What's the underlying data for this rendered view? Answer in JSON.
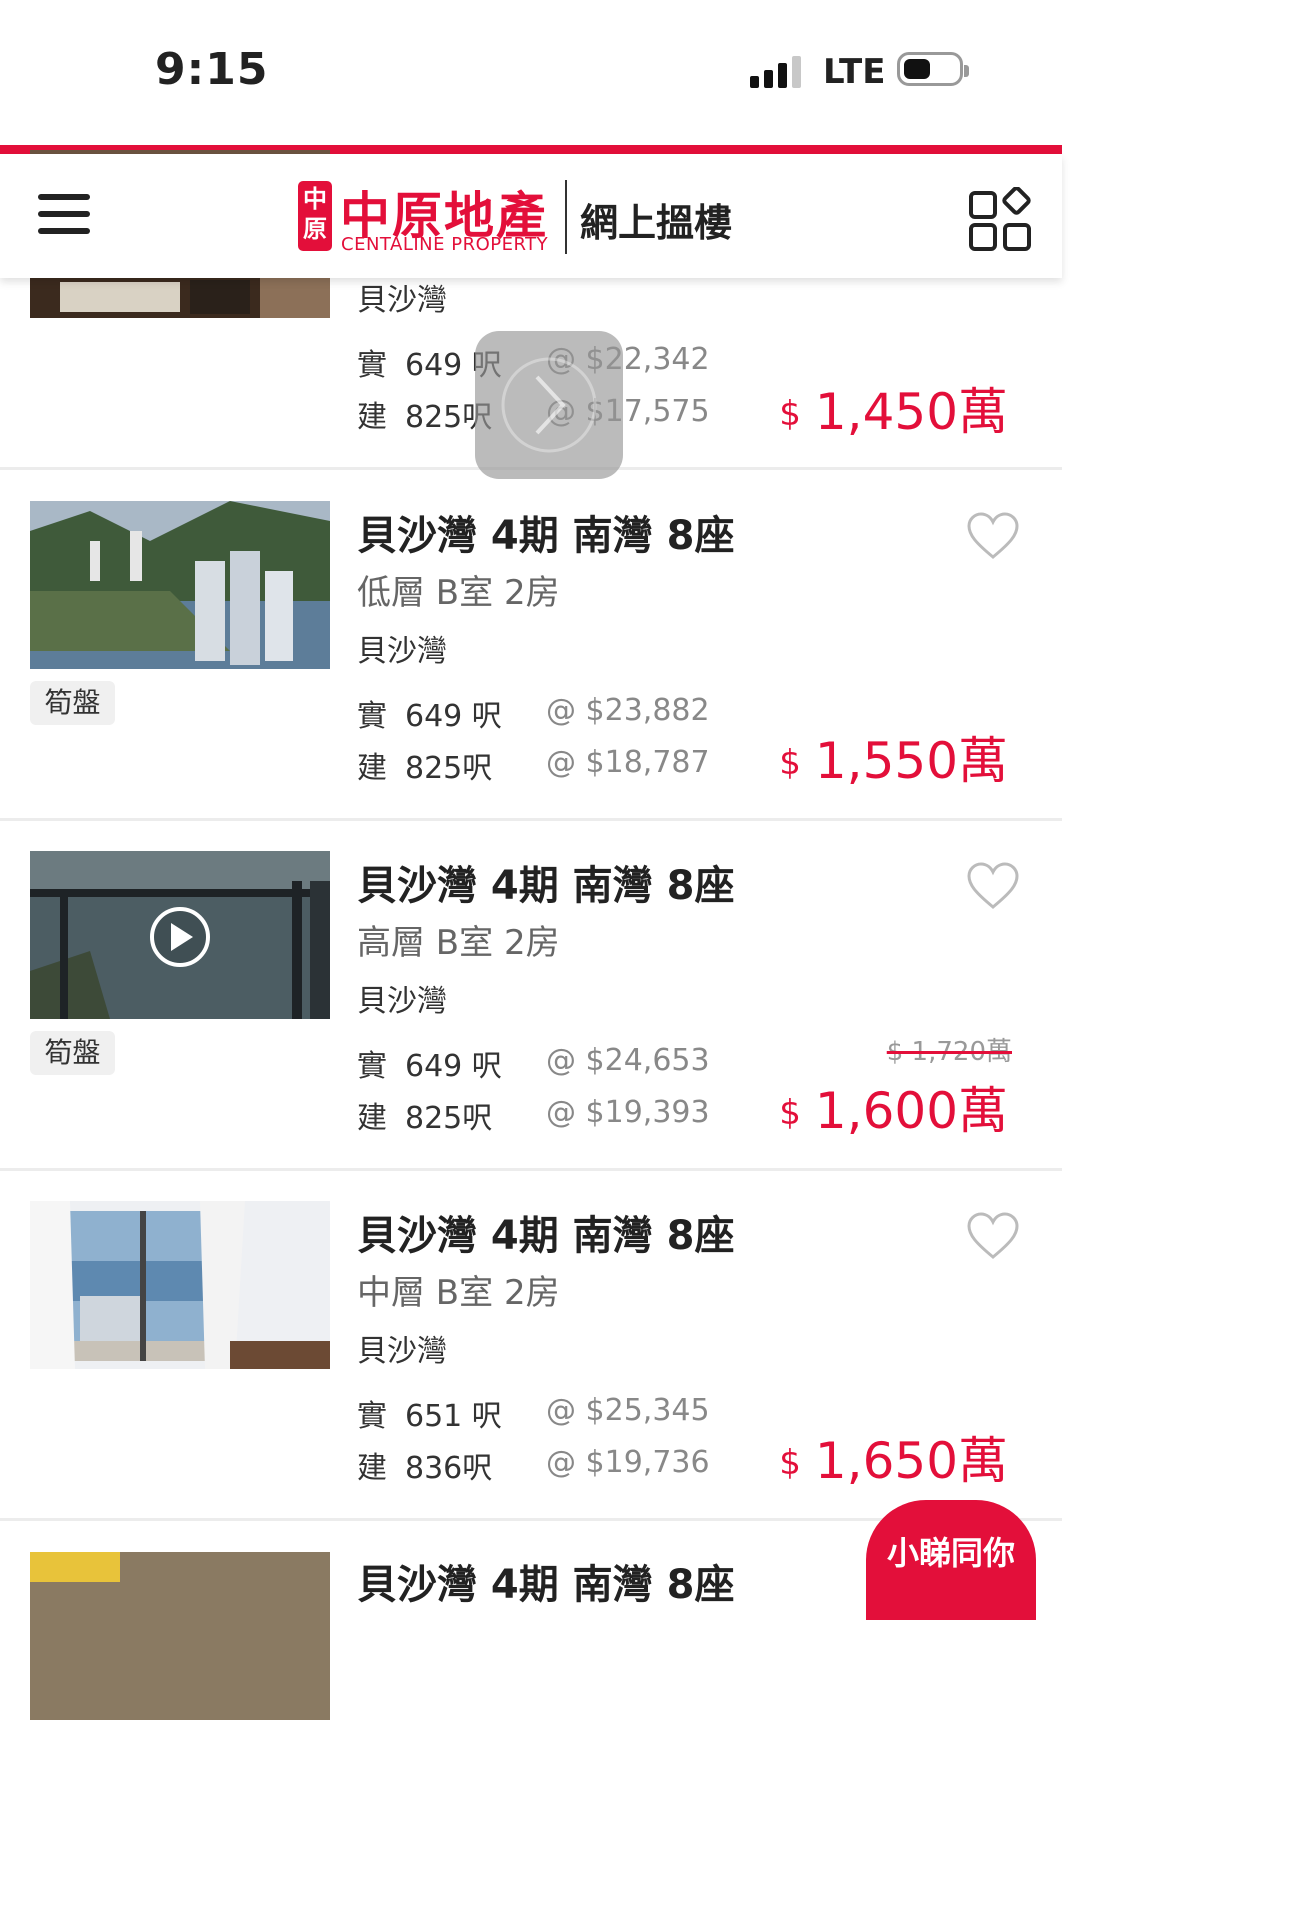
{
  "status_bar": {
    "time": "9:15",
    "network": "LTE"
  },
  "header": {
    "logo_seal": "中原",
    "logo_name": "中原地產",
    "logo_english": "CENTALINE PROPERTY",
    "tagline": "網上搵樓",
    "menu_icon": "hamburger-menu-icon",
    "apps_icon": "apps-grid-icon"
  },
  "colors": {
    "brand_red": "#e30f3a",
    "text": "#222222",
    "muted": "#888888"
  },
  "listings": [
    {
      "title": "",
      "subtitle": "",
      "district": "貝沙灣",
      "tag": "",
      "net_label": "實",
      "net_area": "649 呎",
      "net_unit_price": "@ $22,342",
      "gross_label": "建",
      "gross_area": "825呎",
      "gross_unit_price": "@ $17,575",
      "currency": "$",
      "price": "1,450萬",
      "old_price": ""
    },
    {
      "title": "貝沙灣 4期 南灣 8座",
      "subtitle": "低層 B室 2房",
      "district": "貝沙灣",
      "tag": "筍盤",
      "net_label": "實",
      "net_area": "649 呎",
      "net_unit_price": "@ $23,882",
      "gross_label": "建",
      "gross_area": "825呎",
      "gross_unit_price": "@ $18,787",
      "currency": "$",
      "price": "1,550萬",
      "old_price": ""
    },
    {
      "title": "貝沙灣 4期 南灣 8座",
      "subtitle": "高層 B室 2房",
      "district": "貝沙灣",
      "tag": "筍盤",
      "net_label": "實",
      "net_area": "649 呎",
      "net_unit_price": "@ $24,653",
      "gross_label": "建",
      "gross_area": "825呎",
      "gross_unit_price": "@ $19,393",
      "currency": "$",
      "price": "1,600萬",
      "old_price": "$ 1,720萬"
    },
    {
      "title": "貝沙灣 4期 南灣 8座",
      "subtitle": "中層 B室 2房",
      "district": "貝沙灣",
      "tag": "",
      "net_label": "實",
      "net_area": "651 呎",
      "net_unit_price": "@ $25,345",
      "gross_label": "建",
      "gross_area": "836呎",
      "gross_unit_price": "@ $19,736",
      "currency": "$",
      "price": "1,650萬",
      "old_price": ""
    },
    {
      "title": "貝沙灣 4期 南灣 8座",
      "subtitle": "",
      "district": "",
      "tag": "",
      "net_label": "",
      "net_area": "",
      "net_unit_price": "",
      "gross_label": "",
      "gross_area": "",
      "gross_unit_price": "",
      "currency": "",
      "price": "",
      "old_price": ""
    }
  ],
  "chat_button": {
    "label": "小睇同你"
  }
}
